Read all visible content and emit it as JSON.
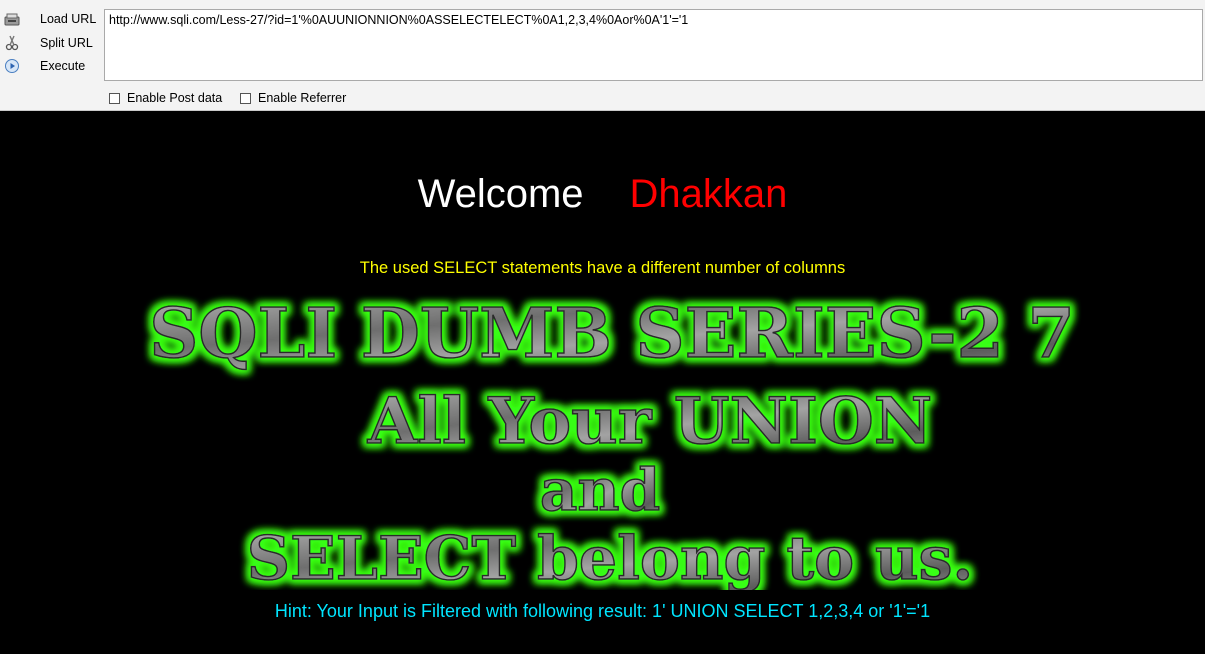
{
  "toolbar": {
    "load_url_label": "Load URL",
    "split_url_label": "Split URL",
    "execute_label": "Execute",
    "url_value": "http://www.sqli.com/Less-27/?id=1'%0AUUNIONNION%0ASSELECTELECT%0A1,2,3,4%0Aor%0A'1'='1",
    "enable_post_label": "Enable Post data",
    "enable_referrer_label": "Enable Referrer",
    "icons": {
      "load": "load-url-icon",
      "split": "split-url-icon",
      "execute": "execute-icon"
    }
  },
  "page": {
    "welcome": "Welcome",
    "user": "Dhakkan",
    "error_message": "The used SELECT statements have a different number of columns",
    "banner_title": "SQLI DUMB SERIES-2 7",
    "banner_line1": "All Your UNION",
    "banner_line2": "and",
    "banner_line3": "SELECT belong to us.",
    "hint": "Hint: Your Input is Filtered with following result: 1' UNION SELECT 1,2,3,4 or '1'='1"
  },
  "colors": {
    "background": "#000000",
    "welcome": "#ffffff",
    "user": "#ff0000",
    "error": "#ffff00",
    "hint": "#00e5ff",
    "banner_glow": "#39ff14",
    "banner_fill": "#8c8c8c"
  }
}
